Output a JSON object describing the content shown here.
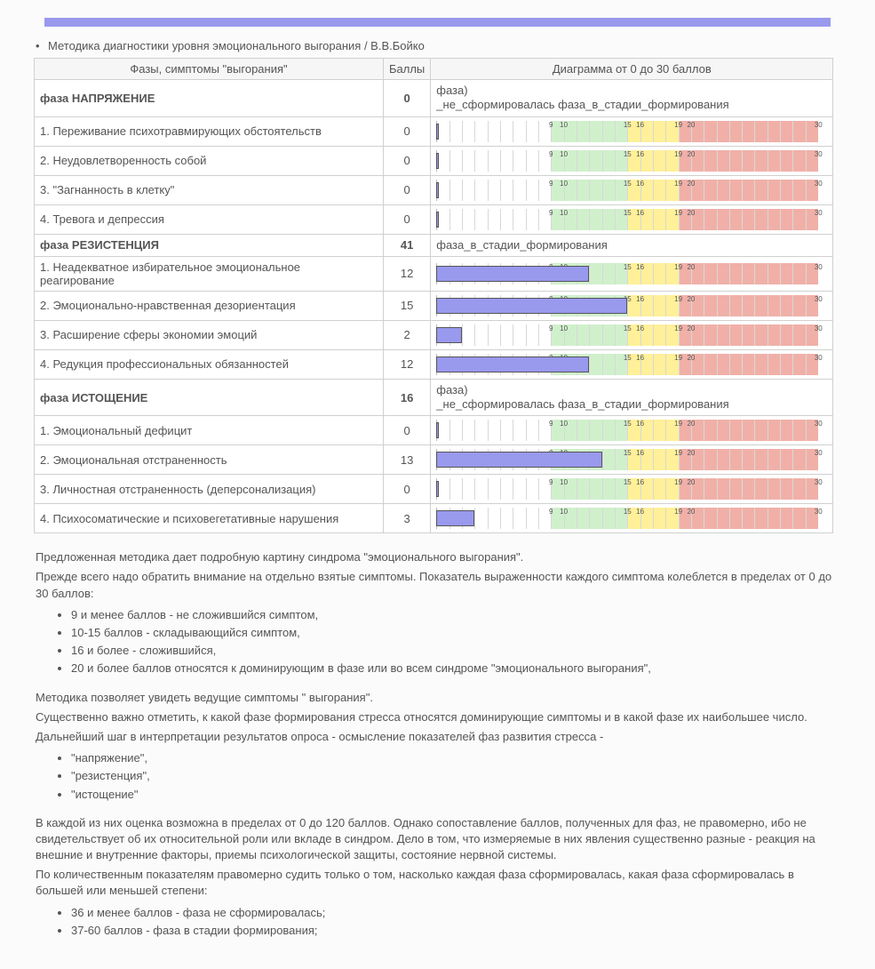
{
  "title": "Методика диагностики уровня эмоционального выгорания / В.В.Бойко",
  "headers": {
    "col1": "Фазы, симптомы \"выгорания\"",
    "col2": "Баллы",
    "col3": "Диаграмма от 0 до 30 баллов"
  },
  "phase_diag_unformed": "фаза)\n_не_сформировалась",
  "phase_diag_forming": "фаза_в_стадии_формирования",
  "rows": [
    {
      "type": "phase",
      "label": "фаза НАПРЯЖЕНИЕ",
      "score": 0,
      "diag": "фаза)\n_не_сформировалась фаза_в_стадии_формирования"
    },
    {
      "type": "sym",
      "label": "1. Переживание психотравмирующих обстоятельств",
      "score": 0
    },
    {
      "type": "sym",
      "label": "2. Неудовлетворенность собой",
      "score": 0
    },
    {
      "type": "sym",
      "label": "3. \"Загнанность в клетку\"",
      "score": 0
    },
    {
      "type": "sym",
      "label": "4. Тревога и депрессия",
      "score": 0
    },
    {
      "type": "phase",
      "label": "фаза РЕЗИСТЕНЦИЯ",
      "score": 41,
      "diag": "фаза_в_стадии_формирования"
    },
    {
      "type": "sym",
      "label": "1. Неадекватное избирательное эмоциональное реагирование",
      "score": 12
    },
    {
      "type": "sym",
      "label": "2. Эмоционально-нравственная дезориентация",
      "score": 15
    },
    {
      "type": "sym",
      "label": "3. Расширение сферы экономии эмоций",
      "score": 2
    },
    {
      "type": "sym",
      "label": "4. Редукция профессиональных обязанностей",
      "score": 12
    },
    {
      "type": "phase",
      "label": "фаза ИСТОЩЕНИЕ",
      "score": 16,
      "diag": "фаза)\n_не_сформировалась фаза_в_стадии_формирования"
    },
    {
      "type": "sym",
      "label": "1. Эмоциональный дефицит",
      "score": 0
    },
    {
      "type": "sym",
      "label": "2. Эмоциональная отстраненность",
      "score": 13
    },
    {
      "type": "sym",
      "label": "3. Личностная отстраненность (деперсонализация)",
      "score": 0
    },
    {
      "type": "sym",
      "label": "4. Психосоматические и психовегетативные нарушения",
      "score": 3
    }
  ],
  "bar_ticks": [
    9,
    10,
    15,
    16,
    19,
    20,
    30
  ],
  "bar_zones": {
    "green_start": 10,
    "green_end": 15,
    "yellow_start": 16,
    "yellow_end": 19,
    "red_start": 20,
    "red_end": 30
  },
  "chart_data": {
    "type": "bar",
    "title": "Диаграмма от 0 до 30 баллов",
    "xlabel": "Баллы",
    "ylabel": "",
    "xlim": [
      0,
      30
    ],
    "series": [
      {
        "name": "фаза НАПРЯЖЕНИЕ (сумма 0)",
        "items": [
          {
            "label": "Переживание психотравмирующих обстоятельств",
            "value": 0
          },
          {
            "label": "Неудовлетворенность собой",
            "value": 0
          },
          {
            "label": "\"Загнанность в клетку\"",
            "value": 0
          },
          {
            "label": "Тревога и депрессия",
            "value": 0
          }
        ]
      },
      {
        "name": "фаза РЕЗИСТЕНЦИЯ (сумма 41)",
        "items": [
          {
            "label": "Неадекватное избирательное эмоциональное реагирование",
            "value": 12
          },
          {
            "label": "Эмоционально-нравственная дезориентация",
            "value": 15
          },
          {
            "label": "Расширение сферы экономии эмоций",
            "value": 2
          },
          {
            "label": "Редукция профессиональных обязанностей",
            "value": 12
          }
        ]
      },
      {
        "name": "фаза ИСТОЩЕНИЕ (сумма 16)",
        "items": [
          {
            "label": "Эмоциональный дефицит",
            "value": 0
          },
          {
            "label": "Эмоциональная отстраненность",
            "value": 13
          },
          {
            "label": "Личностная отстраненность (деперсонализация)",
            "value": 0
          },
          {
            "label": "Психосоматические и психовегетативные нарушения",
            "value": 3
          }
        ]
      }
    ],
    "zones": [
      {
        "label": "не сложившийся симптом",
        "range": [
          0,
          9
        ]
      },
      {
        "label": "складывающийся симптом",
        "range": [
          10,
          15
        ]
      },
      {
        "label": "сложившийся",
        "range": [
          16,
          30
        ]
      },
      {
        "label": "доминирующий",
        "range": [
          20,
          30
        ]
      }
    ]
  },
  "desc": {
    "p1": "Предложенная методика дает подробную картину синдрома \"эмоционального выгорания\".",
    "p2": "Прежде всего надо обратить внимание на отдельно взятые симптомы. Показатель выраженности каждого симптома колеблется в пределах от 0 до 30 баллов:",
    "ul1": [
      "9 и менее баллов - не сложившийся симптом,",
      "10-15 баллов - складывающийся симптом,",
      "16 и более - сложившийся,",
      "20 и более баллов относятся к доминирующим в фазе или во всем синдроме \"эмоционального выгорания\","
    ],
    "p3": "Методика позволяет увидеть ведущие симптомы \" выгорания\".",
    "p4": "Существенно важно отметить, к какой фазе формирования стресса относятся доминирующие симптомы и в какой фазе их наибольшее число.",
    "p5": "Дальнейший шаг в интерпретации результатов опроса - осмысление показателей фаз развития стресса -",
    "ul2": [
      "\"напряжение\",",
      "\"резистенция\",",
      "\"истощение\""
    ],
    "p6": "В каждой из них оценка возможна в пределах от 0 до 120 баллов. Однако сопоставление баллов, полученных для фаз, не правомерно, ибо не свидетельствует об их относительной роли или вкладе в синдром. Дело в том, что измеряемые в них явления существенно разные - реакция на внешние и внутренние факторы, приемы психологической защиты, состояние нервной системы.",
    "p7": "По количественным показателям правомерно судить только о том, насколько каждая фаза сформировалась, какая фаза сформировалась в большей или меньшей степени:",
    "ul3": [
      "36 и менее баллов - фаза не сформировалась;",
      "37-60 баллов - фаза в стадии формирования;"
    ]
  }
}
